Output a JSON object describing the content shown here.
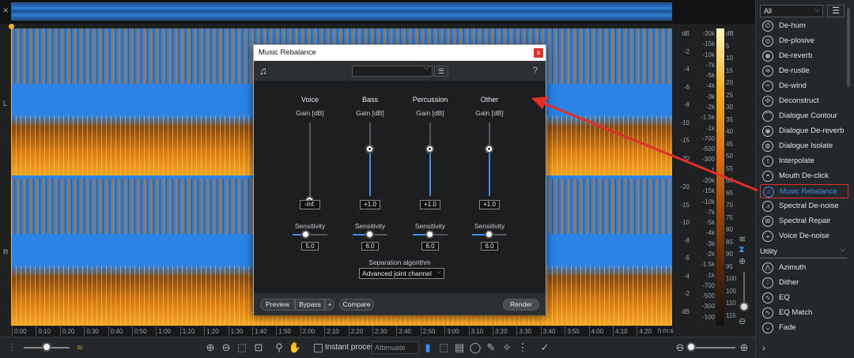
{
  "dialog": {
    "title": "Music Rebalance",
    "close": "x",
    "help": "?",
    "columns": [
      {
        "name": "Voice",
        "gain_label": "Gain [dB]",
        "gain_value": "-Inf.",
        "sens_label": "Sensitivity",
        "sens_value": "5.0"
      },
      {
        "name": "Bass",
        "gain_label": "Gain [dB]",
        "gain_value": "+1.0",
        "sens_label": "Sensitivity",
        "sens_value": "6.0"
      },
      {
        "name": "Percussion",
        "gain_label": "Gain [dB]",
        "gain_value": "+1.0",
        "sens_label": "Sensitivity",
        "sens_value": "6.0"
      },
      {
        "name": "Other",
        "gain_label": "Gain [dB]",
        "gain_value": "+1.0",
        "sens_label": "Sensitivity",
        "sens_value": "6.0"
      }
    ],
    "separation_label": "Separation algorithm",
    "separation_value": "Advanced joint channel",
    "buttons": {
      "preview": "Preview",
      "bypass": "Bypass",
      "plus": "+",
      "compare": "Compare",
      "render": "Render"
    }
  },
  "modules": {
    "filter": "All",
    "items": [
      "De-hum",
      "De-plosive",
      "De-reverb",
      "De-rustle",
      "De-wind",
      "Deconstruct",
      "Dialogue Contour",
      "Dialogue De-reverb",
      "Dialogue Isolate",
      "Interpolate",
      "Mouth De-click",
      "Music Rebalance",
      "Spectral De-noise",
      "Spectral Repair",
      "Voice De-noise"
    ],
    "active": "Music Rebalance",
    "utility_header": "Utility",
    "utility_items": [
      "Azimuth",
      "Dither",
      "EQ",
      "EQ Match",
      "Fade"
    ]
  },
  "channels": {
    "left": "L",
    "right": "R"
  },
  "db_scale": {
    "top": [
      "dB",
      "-2",
      "-4",
      "-6",
      "-8",
      "-10",
      "-15",
      "-20"
    ],
    "bottom": [
      "-20",
      "-15",
      "-10",
      "-8",
      "-6",
      "-4",
      "-2",
      "dB"
    ]
  },
  "hz_scale": {
    "top": [
      "-20k",
      "-15k",
      "-10k",
      "-7k",
      "-5k",
      "-4k",
      "-3k",
      "-2k",
      "-1.5k",
      "-1k",
      "-700",
      "-500",
      "-300",
      "-1"
    ],
    "bottom": [
      "-20k",
      "-15k",
      "-10k",
      "-7k",
      "-5k",
      "-4k",
      "-3k",
      "-2k",
      "-1.5k",
      "-1k",
      "-700",
      "-500",
      "-300",
      "-100"
    ]
  },
  "meter_scale": [
    "dB",
    "5",
    "10",
    "15",
    "20",
    "25",
    "30",
    "35",
    "40",
    "45",
    "50",
    "55",
    "60",
    "65",
    "70",
    "75",
    "80",
    "85",
    "90",
    "95",
    "100",
    "105",
    "110",
    "115"
  ],
  "timeline": {
    "ticks": [
      "0:00",
      "0:10",
      "0:20",
      "0:30",
      "0:40",
      "0:50",
      "1:00",
      "1:10",
      "1:20",
      "1:30",
      "1:40",
      "1:50",
      "2:00",
      "2:10",
      "2:20",
      "2:30",
      "2:40",
      "2:50",
      "3:00",
      "3:10",
      "3:20",
      "3:30",
      "3:40",
      "3:50",
      "4:00",
      "4:10",
      "4:20"
    ],
    "unit": "h:m:s"
  },
  "toolbar": {
    "instant_process": "Instant process",
    "attenuate": "Attenuate"
  },
  "colors": {
    "accent": "#3e8ee8",
    "spectrum_blue": "#2b83e6",
    "spectrum_orange": "#f6a420",
    "highlight_red": "#e0302a"
  }
}
